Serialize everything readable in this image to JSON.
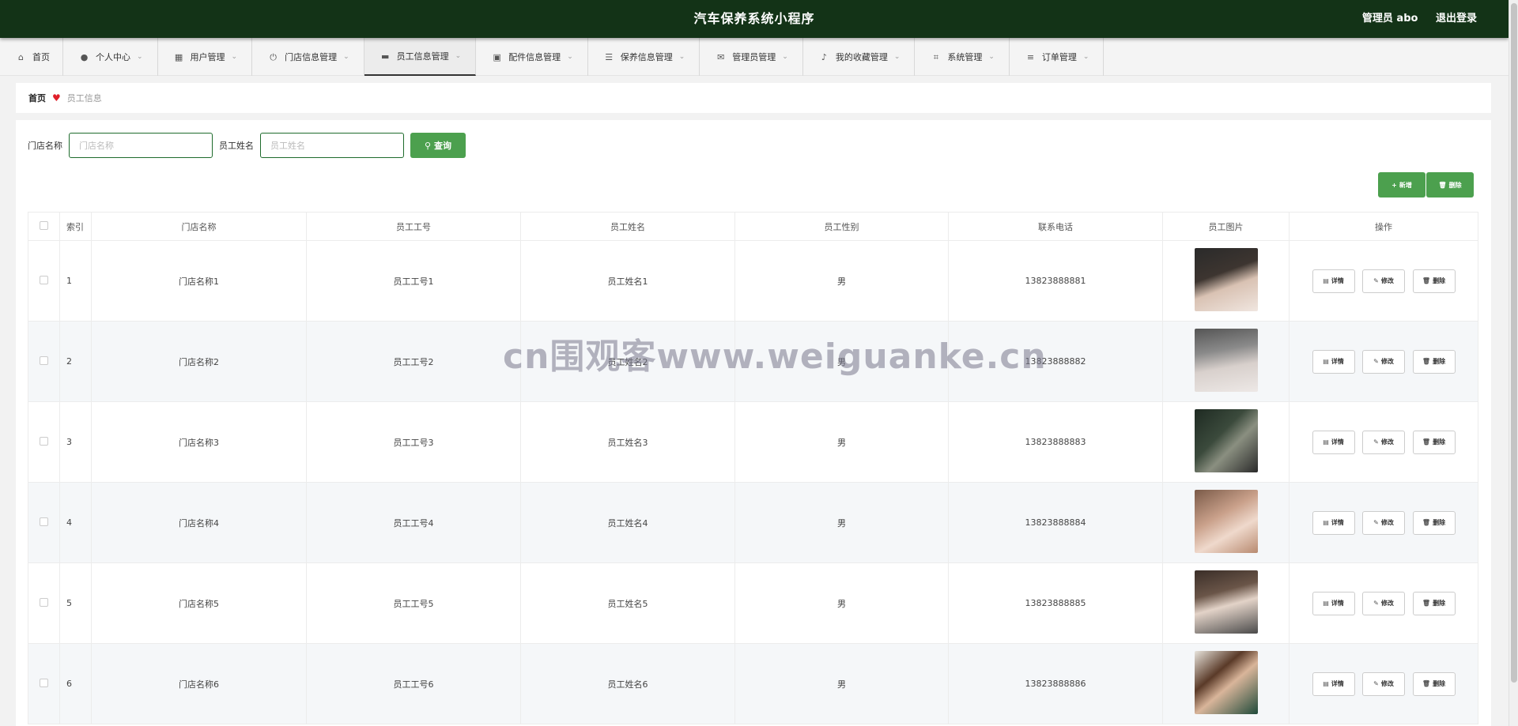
{
  "header": {
    "title": "汽车保养系统小程序",
    "admin_label": "管理员 abo",
    "logout_label": "退出登录"
  },
  "menu": [
    {
      "label": "首页",
      "icon": "home-icon",
      "glyph": "⌂"
    },
    {
      "label": "个人中心",
      "icon": "user-icon",
      "glyph": "●"
    },
    {
      "label": "用户管理",
      "icon": "grid-icon",
      "glyph": "▦"
    },
    {
      "label": "门店信息管理",
      "icon": "power-icon",
      "glyph": "⏻"
    },
    {
      "label": "员工信息管理",
      "icon": "monitor-icon",
      "glyph": "▬"
    },
    {
      "label": "配件信息管理",
      "icon": "briefcase-icon",
      "glyph": "▣"
    },
    {
      "label": "保养信息管理",
      "icon": "sliders-icon",
      "glyph": "☰"
    },
    {
      "label": "管理员管理",
      "icon": "mail-icon",
      "glyph": "✉"
    },
    {
      "label": "我的收藏管理",
      "icon": "bell-icon",
      "glyph": "♪"
    },
    {
      "label": "系统管理",
      "icon": "crop-icon",
      "glyph": "⌗"
    },
    {
      "label": "订单管理",
      "icon": "list-icon",
      "glyph": "≡"
    }
  ],
  "breadcrumb": {
    "home": "首页",
    "current": "员工信息"
  },
  "search": {
    "store_label": "门店名称",
    "store_placeholder": "门店名称",
    "name_label": "员工姓名",
    "name_placeholder": "员工姓名",
    "query_label": "查询"
  },
  "actions": {
    "add_label": "新增",
    "delete_label": "删除"
  },
  "table": {
    "columns": [
      "索引",
      "门店名称",
      "员工工号",
      "员工姓名",
      "员工性别",
      "联系电话",
      "员工图片",
      "操作"
    ],
    "rows": [
      {
        "index": "1",
        "store": "门店名称1",
        "emp_no": "员工工号1",
        "name": "员工姓名1",
        "gender": "男",
        "phone": "13823888881"
      },
      {
        "index": "2",
        "store": "门店名称2",
        "emp_no": "员工工号2",
        "name": "员工姓名2",
        "gender": "男",
        "phone": "13823888882"
      },
      {
        "index": "3",
        "store": "门店名称3",
        "emp_no": "员工工号3",
        "name": "员工姓名3",
        "gender": "男",
        "phone": "13823888883"
      },
      {
        "index": "4",
        "store": "门店名称4",
        "emp_no": "员工工号4",
        "name": "员工姓名4",
        "gender": "男",
        "phone": "13823888884"
      },
      {
        "index": "5",
        "store": "门店名称5",
        "emp_no": "员工工号5",
        "name": "员工姓名5",
        "gender": "男",
        "phone": "13823888885"
      },
      {
        "index": "6",
        "store": "门店名称6",
        "emp_no": "员工工号6",
        "name": "员工姓名6",
        "gender": "男",
        "phone": "13823888886"
      }
    ],
    "op_labels": {
      "detail": "详情",
      "edit": "修改",
      "delete": "删除"
    }
  },
  "watermark": "cn围观客www.weiguanke.cn",
  "colors": {
    "header_bg": "#133317",
    "primary_green": "#4ca04e",
    "heart_red": "#e0202a"
  }
}
